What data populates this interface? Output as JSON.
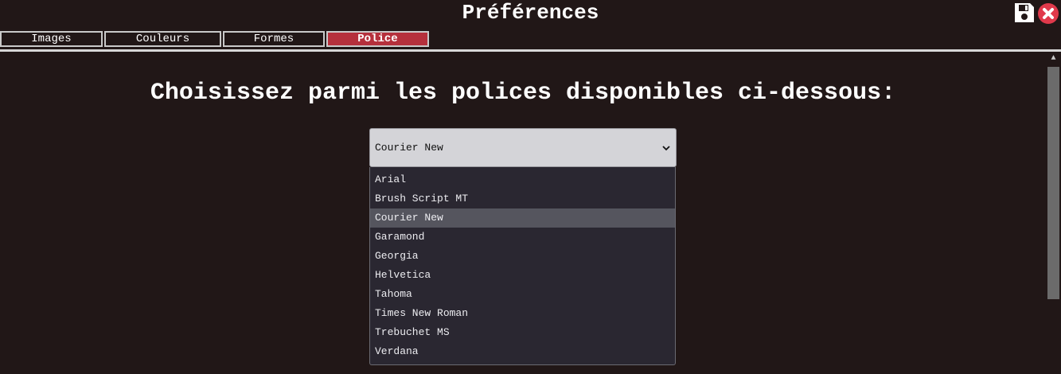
{
  "window": {
    "title": "Préférences"
  },
  "toolbar": {
    "save_icon": "floppy-disk-icon",
    "close_icon": "close-circle-icon",
    "close_color": "#e0394b"
  },
  "tabs": [
    {
      "label": "Images",
      "active": false
    },
    {
      "label": "Couleurs",
      "active": false
    },
    {
      "label": "Formes",
      "active": false
    },
    {
      "label": "Police",
      "active": true
    }
  ],
  "colors": {
    "background": "#211717",
    "active_tab": "#b5303c",
    "tab_border": "#c9c9c9"
  },
  "main": {
    "heading": "Choisissez parmi les polices disponibles ci-dessous:",
    "font_select": {
      "selected_value": "Courier New",
      "open": true,
      "options": [
        "Arial",
        "Brush Script MT",
        "Courier New",
        "Garamond",
        "Georgia",
        "Helvetica",
        "Tahoma",
        "Times New Roman",
        "Trebuchet MS",
        "Verdana"
      ]
    }
  }
}
